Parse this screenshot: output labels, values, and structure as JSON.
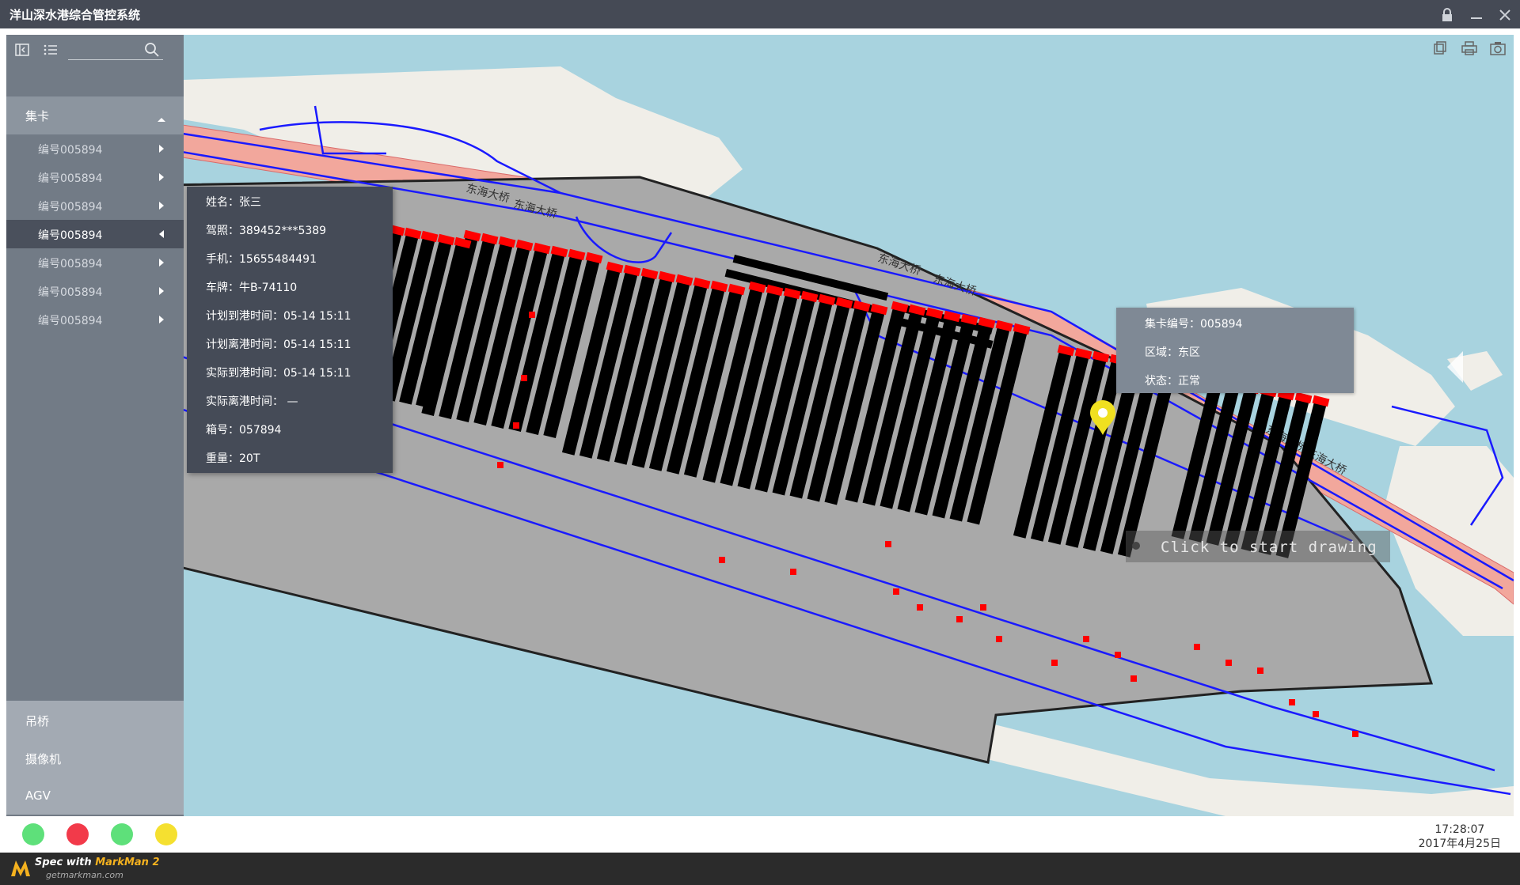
{
  "window": {
    "title": "洋山深水港综合管控系统",
    "controls": [
      "lock-icon",
      "minimize-icon",
      "close-icon"
    ]
  },
  "sidebar": {
    "toolbar": {
      "icons": [
        "collapse-icon",
        "list-icon",
        "search-icon"
      ],
      "search_placeholder": ""
    },
    "category": {
      "label": "集卡",
      "expanded": true
    },
    "items": [
      {
        "label": "编号005894",
        "active": false
      },
      {
        "label": "编号005894",
        "active": false
      },
      {
        "label": "编号005894",
        "active": false
      },
      {
        "label": "编号005894",
        "active": true
      },
      {
        "label": "编号005894",
        "active": false
      },
      {
        "label": "编号005894",
        "active": false
      },
      {
        "label": "编号005894",
        "active": false
      }
    ],
    "bottom_categories": [
      {
        "label": "吊桥"
      },
      {
        "label": "摄像机"
      },
      {
        "label": "AGV"
      }
    ]
  },
  "detail": {
    "rows": [
      "姓名：张三",
      "驾照：389452***5389",
      "手机：15655484491",
      "车牌：牛B-74110",
      "计划到港时间：05-14  15:11",
      "计划离港时间：05-14  15:11",
      "实际到港时间：05-14  15:11",
      "实际离港时间：  —",
      "箱号：057894",
      "重量：20T"
    ]
  },
  "map": {
    "road_labels": [
      "东海大桥",
      "东海大桥",
      "东海大桥",
      "东海大桥",
      "东海大桥",
      "东海大桥"
    ],
    "corner_tools": [
      "copy-icon",
      "print-icon",
      "camera-icon"
    ],
    "tooltip": {
      "rows": [
        "集卡编号：005894",
        "区域：东区",
        "状态：正常"
      ]
    },
    "draw_hint": "Click to start drawing",
    "colors": {
      "water": "#a8d3df",
      "land": "#f0eee8",
      "terminal": "#a9a9a9",
      "bridge": "#f2a79c",
      "road": "#1a1aff",
      "container": "#000000",
      "vehicle": "#ff0000",
      "marker": "#f0e020"
    }
  },
  "status": {
    "lights": [
      {
        "name": "green",
        "color": "#5ee07a"
      },
      {
        "name": "red",
        "color": "#f23a4a"
      },
      {
        "name": "green",
        "color": "#5ee07a"
      },
      {
        "name": "yellow",
        "color": "#f5e030"
      }
    ],
    "time": "17:28:07",
    "date": "2017年4月25日"
  },
  "footer": {
    "brand_prefix": "Spec with ",
    "brand_name": "MarkMan 2",
    "site": "getmarkman.com"
  }
}
